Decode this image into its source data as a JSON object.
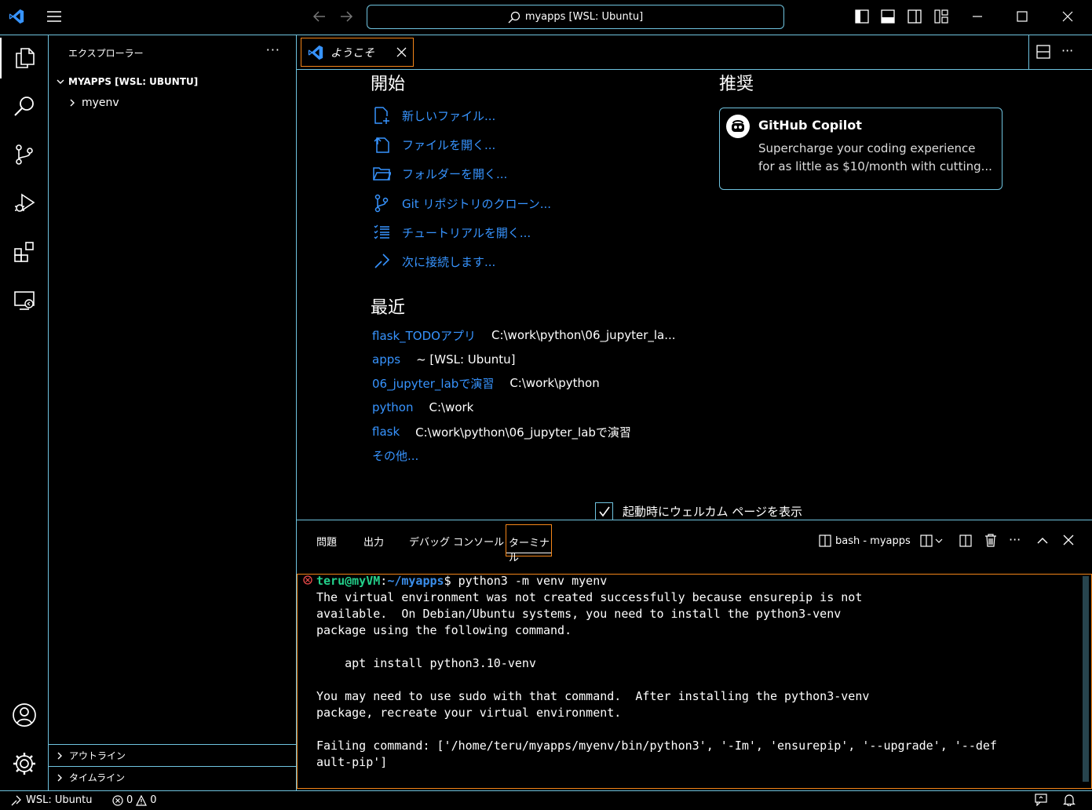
{
  "titlebar": {
    "search_text": "myapps [WSL: Ubuntu]"
  },
  "sidebar": {
    "title": "エクスプローラー",
    "more": "···",
    "root_label": "MYAPPS [WSL: UBUNTU]",
    "items": [
      {
        "label": "myenv"
      }
    ],
    "outline_label": "アウトライン",
    "timeline_label": "タイムライン"
  },
  "tab": {
    "label": "ようこそ"
  },
  "welcome": {
    "start_heading": "開始",
    "start_items": [
      {
        "label": "新しいファイル...",
        "icon": "new-file-icon"
      },
      {
        "label": "ファイルを開く...",
        "icon": "open-file-icon"
      },
      {
        "label": "フォルダーを開く...",
        "icon": "open-folder-icon"
      },
      {
        "label": "Git リポジトリのクローン...",
        "icon": "git-clone-icon"
      },
      {
        "label": "チュートリアルを開く...",
        "icon": "tutorial-icon"
      },
      {
        "label": "次に接続します...",
        "icon": "remote-connect-icon"
      }
    ],
    "recent_heading": "最近",
    "recent_items": [
      {
        "name": "flask_TODOアプリ",
        "path": "C:\\work\\python\\06_jupyter_la..."
      },
      {
        "name": "apps",
        "path": "~ [WSL: Ubuntu]"
      },
      {
        "name": "06_jupyter_labで演習",
        "path": "C:\\work\\python"
      },
      {
        "name": "python",
        "path": "C:\\work"
      },
      {
        "name": "flask",
        "path": "C:\\work\\python\\06_jupyter_labで演習"
      }
    ],
    "more_label": "その他...",
    "recommend_heading": "推奨",
    "copilot_title": "GitHub Copilot",
    "copilot_desc_1": "Supercharge your coding experience",
    "copilot_desc_2": "for as little as $10/month with cutting...",
    "show_on_startup_label": "起動時にウェルカム ページを表示"
  },
  "panel": {
    "tabs": [
      "問題",
      "出力",
      "デバッグ コンソール",
      "ターミナル"
    ],
    "terminal_name": "bash - myapps",
    "more": "···"
  },
  "terminal": {
    "user_host": "teru@myVM",
    "colon": ":",
    "path": "~/myapps",
    "prompt_end": "$ ",
    "command": "python3 -m venv myenv",
    "lines": [
      "The virtual environment was not created successfully because ensurepip is not",
      "available.  On Debian/Ubuntu systems, you need to install the python3-venv",
      "package using the following command.",
      "",
      "    apt install python3.10-venv",
      "",
      "You may need to use sudo with that command.  After installing the python3-venv",
      "package, recreate your virtual environment.",
      "",
      "Failing command: ['/home/teru/myapps/myenv/bin/python3', '-Im', 'ensurepip', '--upgrade', '--def",
      "ault-pip']"
    ]
  },
  "statusbar": {
    "remote_label": "WSL: Ubuntu",
    "errors": "0",
    "warnings": "0"
  },
  "colors": {
    "accent_border": "#6fc3df",
    "focus_border": "#f38518",
    "link": "#3794ff",
    "prompt_green": "#23d18b",
    "prompt_blue": "#3b8eea"
  }
}
